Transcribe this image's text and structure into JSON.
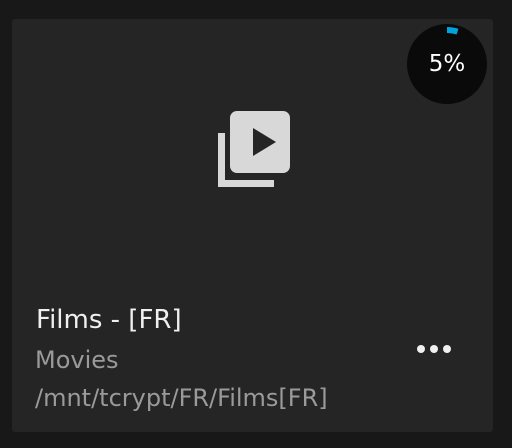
{
  "card": {
    "title": "Films - [FR]",
    "type": "Movies",
    "path": "/mnt/tcrypt/FR/Films[FR]",
    "icon": "video-library-icon",
    "menu_icon": "more-horizontal-icon"
  },
  "progress": {
    "label": "5%",
    "value": 5,
    "track_color": "#0a0a0a",
    "fill_color": "#00a4dc"
  },
  "colors": {
    "background": "#181818",
    "card": "#252525",
    "icon": "#d8d8d8"
  }
}
